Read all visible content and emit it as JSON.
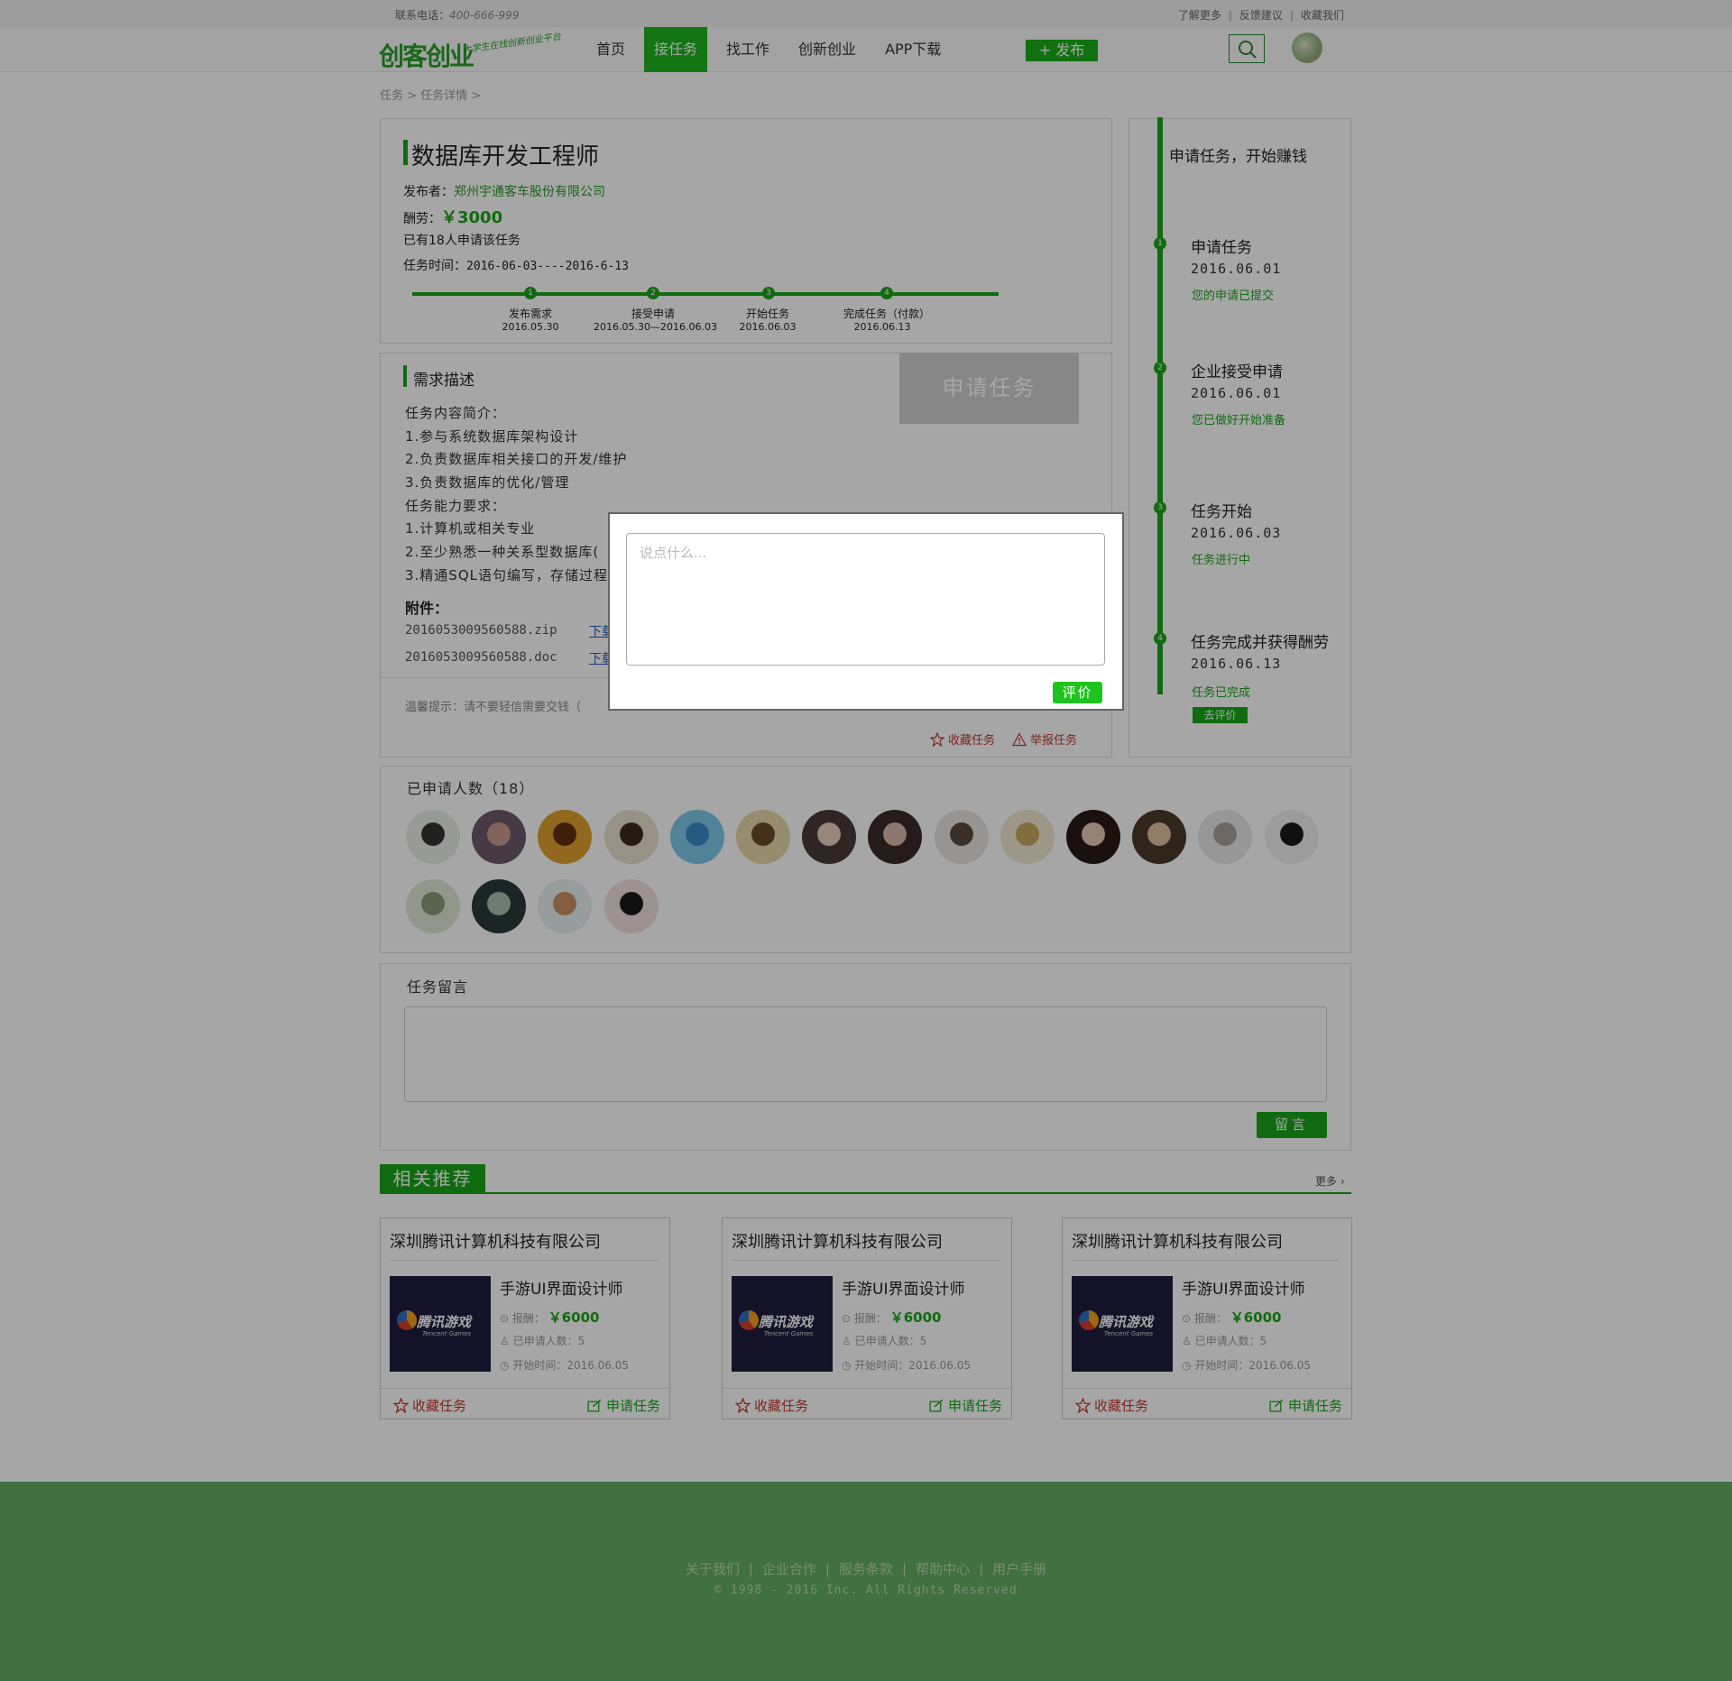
{
  "topbar": {
    "phone_label": "联系电话：",
    "phone_number": "400-666-999",
    "links": [
      "了解更多",
      "反馈建议",
      "收藏我们"
    ]
  },
  "header": {
    "logo_text": "创客创业",
    "logo_slogan": "大学生在线创新创业平台",
    "nav": [
      "首页",
      "接任务",
      "找工作",
      "创新创业",
      "APP下载"
    ],
    "active_nav": "接任务",
    "publish_label": "+ 发布"
  },
  "breadcrumb": "任务 > 任务详情 >",
  "task": {
    "title": "数据库开发工程师",
    "publisher_label": "发布者：",
    "publisher": "郑州宇通客车股份有限公司",
    "pay_label": "酬劳：",
    "pay": "￥3000",
    "applicants_text": "已有18人申请该任务",
    "time_label": "任务时间：",
    "time": "2016-06-03----2016-6-13",
    "progress": [
      {
        "num": "1",
        "label": "发布需求",
        "date": "2016.05.30"
      },
      {
        "num": "2",
        "label": "接受申请",
        "date": "2016.05.30—2016.06.03"
      },
      {
        "num": "3",
        "label": "开始任务",
        "date": "2016.06.03"
      },
      {
        "num": "4",
        "label": "完成任务（付款）",
        "date": "2016.06.13"
      }
    ]
  },
  "description": {
    "title": "需求描述",
    "apply_button": "申请任务",
    "lines": [
      "任务内容简介：",
      "1.参与系统数据库架构设计",
      "2.负责数据库相关接口的开发/维护",
      "3.负责数据库的优化/管理",
      "任务能力要求：",
      "1.计算机或相关专业",
      "2.至少熟悉一种关系型数据库(",
      "3.精通SQL语句编写，存储过程"
    ],
    "attachments_title": "附件：",
    "attachments": [
      "2016053009560588.zip",
      "2016053009560588.doc"
    ],
    "download_label": "下载",
    "hint": "温馨提示：请不要轻信需要交钱（",
    "favorite": "收藏任务",
    "report": "举报任务"
  },
  "sidebar": {
    "title": "申请任务，开始赚钱",
    "steps": [
      {
        "num": "1",
        "title": "申请任务",
        "date": "2016.06.01",
        "status": "您的申请已提交"
      },
      {
        "num": "2",
        "title": "企业接受申请",
        "date": "2016.06.01",
        "status": "您已做好开始准备"
      },
      {
        "num": "3",
        "title": "任务开始",
        "date": "2016.06.03",
        "status": "任务进行中"
      },
      {
        "num": "4",
        "title": "任务完成并获得酬劳",
        "date": "2016.06.13",
        "status": "任务已完成"
      }
    ],
    "rate_button": "去评价"
  },
  "applicants": {
    "title": "已申请人数（18）",
    "count": 18
  },
  "comments": {
    "title": "任务留言",
    "submit": "留言"
  },
  "recommend": {
    "title": "相关推荐",
    "more": "更多",
    "cards": [
      {
        "company": "深圳腾讯计算机科技有限公司",
        "logo_text": "腾讯游戏",
        "logo_sub": "Tencent Games",
        "job": "手游UI界面设计师",
        "pay_label": "报酬：",
        "pay": "￥6000",
        "applied": "已申请人数：5",
        "start": "开始时间：2016.06.05",
        "fav": "收藏任务",
        "apply": "申请任务"
      },
      {
        "company": "深圳腾讯计算机科技有限公司",
        "logo_text": "腾讯游戏",
        "logo_sub": "Tencent Games",
        "job": "手游UI界面设计师",
        "pay_label": "报酬：",
        "pay": "￥6000",
        "applied": "已申请人数：5",
        "start": "开始时间：2016.06.05",
        "fav": "收藏任务",
        "apply": "申请任务"
      },
      {
        "company": "深圳腾讯计算机科技有限公司",
        "logo_text": "腾讯游戏",
        "logo_sub": "Tencent Games",
        "job": "手游UI界面设计师",
        "pay_label": "报酬：",
        "pay": "￥6000",
        "applied": "已申请人数：5",
        "start": "开始时间：2016.06.05",
        "fav": "收藏任务",
        "apply": "申请任务"
      }
    ]
  },
  "footer": {
    "links": [
      "关于我们",
      "企业合作",
      "服务条款",
      "帮助中心",
      "用户手册"
    ],
    "copyright": "© 1998 - 2016  Inc. All Rights Reserved"
  },
  "modal": {
    "placeholder": "说点什么...",
    "submit": "评价"
  },
  "colors": {
    "accent": "#1aa51a",
    "footer": "#64ac64",
    "overlay": "rgba(0,0,0,0.35)"
  }
}
